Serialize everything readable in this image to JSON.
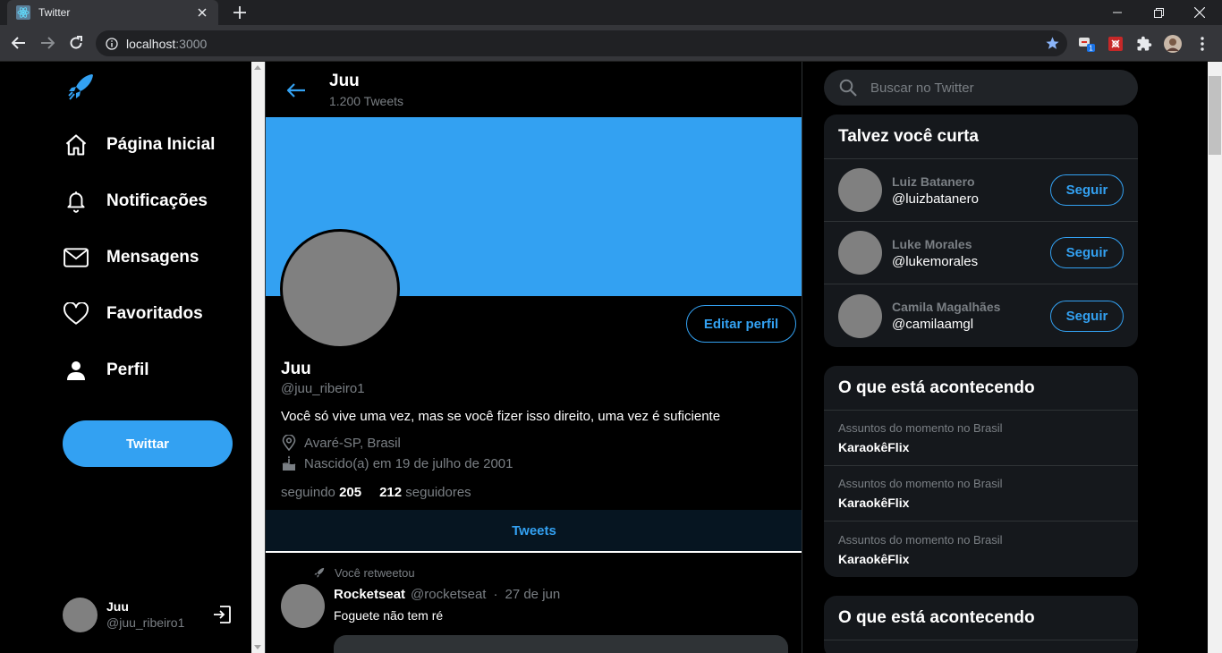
{
  "browser": {
    "tab_title": "Twitter",
    "url_host": "localhost",
    "url_port": ":3000",
    "extension_badge": "1"
  },
  "sidebar": {
    "items": [
      {
        "label": "Página Inicial",
        "icon": "home-icon"
      },
      {
        "label": "Notificações",
        "icon": "bell-icon"
      },
      {
        "label": "Mensagens",
        "icon": "mail-icon"
      },
      {
        "label": "Favoritados",
        "icon": "heart-icon"
      },
      {
        "label": "Perfil",
        "icon": "person-icon"
      }
    ],
    "tweet_button": "Twittar",
    "user": {
      "name": "Juu",
      "handle": "@juu_ribeiro1"
    }
  },
  "profile": {
    "header_name": "Juu",
    "header_count": "1.200 Tweets",
    "edit_button": "Editar perfil",
    "name": "Juu",
    "handle": "@juu_ribeiro1",
    "bio": "Você só vive uma vez, mas se você fizer isso direito, uma vez é suficiente",
    "location": "Avaré-SP, Brasil",
    "birth": "Nascido(a) em 19 de julho de 2001",
    "following_label": "seguindo",
    "following_count": "205",
    "followers_count": "212",
    "followers_label": "seguidores",
    "tab": "Tweets"
  },
  "tweet": {
    "retweet_label": "Você retweetou",
    "name": "Rocketseat",
    "handle": "@rocketseat",
    "separator": "·",
    "date": "27 de jun",
    "body": "Foguete não tem ré"
  },
  "right": {
    "search_placeholder": "Buscar no Twitter",
    "follow_card": {
      "title": "Talvez você curta",
      "users": [
        {
          "name": "Luiz Batanero",
          "handle": "@luizbatanero",
          "button": "Seguir"
        },
        {
          "name": "Luke Morales",
          "handle": "@lukemorales",
          "button": "Seguir"
        },
        {
          "name": "Camila Magalhães",
          "handle": "@camilaamgl",
          "button": "Seguir"
        }
      ]
    },
    "trends_card": {
      "title": "O que está acontecendo",
      "items": [
        {
          "category": "Assuntos do momento no Brasil",
          "name": "KaraokêFlix"
        },
        {
          "category": "Assuntos do momento no Brasil",
          "name": "KaraokêFlix"
        },
        {
          "category": "Assuntos do momento no Brasil",
          "name": "KaraokêFlix"
        }
      ]
    },
    "trends_card2": {
      "title": "O que está acontecendo"
    }
  },
  "colors": {
    "accent": "#33a1f2",
    "background": "#000000",
    "card": "#15181c",
    "muted": "#7a7f84"
  }
}
